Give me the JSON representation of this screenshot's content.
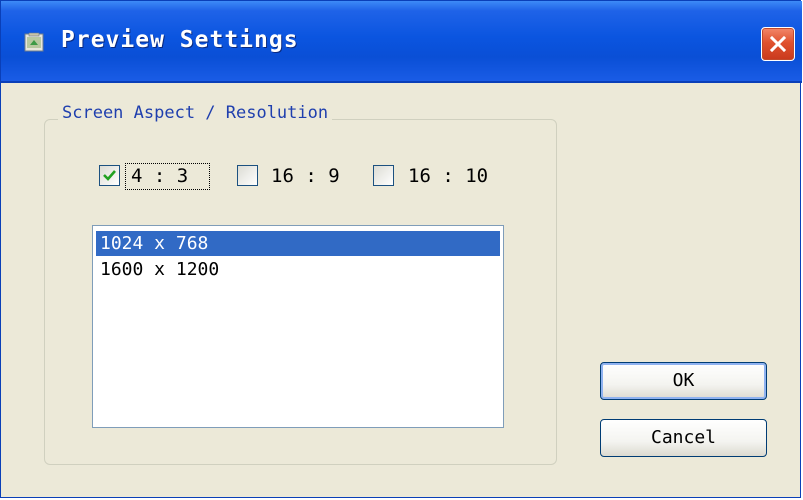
{
  "window": {
    "title": "Preview Settings",
    "title_icon": "app-settings-icon",
    "close_icon": "close-icon",
    "close_color": "#e0522f",
    "titlebar_color": "#0b55e0"
  },
  "aspect_group": {
    "label": "Screen Aspect / Resolution",
    "options": [
      {
        "label": "4 : 3",
        "checked": true
      },
      {
        "label": "16 : 9",
        "checked": false
      },
      {
        "label": "16 : 10",
        "checked": false
      }
    ]
  },
  "resolutions": {
    "items": [
      "1024 x 768",
      "1600 x 1200"
    ],
    "selected": "1024 x 768",
    "selection_color": "#316ac5"
  },
  "buttons": {
    "ok_label": "OK",
    "cancel_label": "Cancel"
  }
}
